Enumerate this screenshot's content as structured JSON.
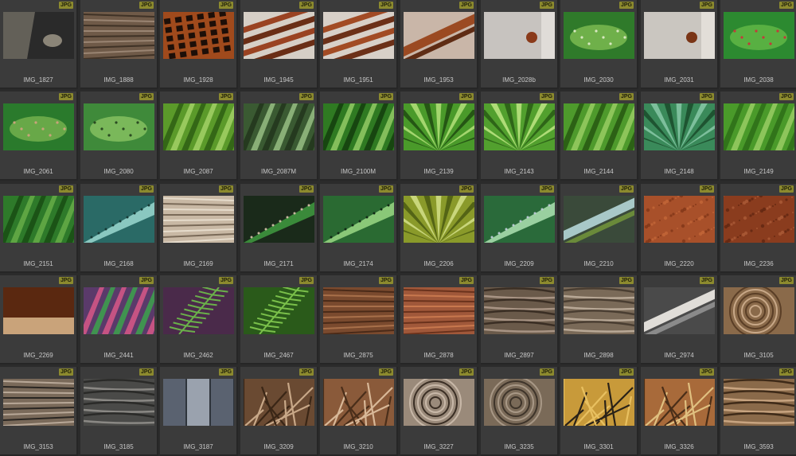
{
  "browser": {
    "badge_label": "JPG",
    "items": [
      {
        "name": "IMG_1827",
        "colors": [
          "#2a2a2a",
          "#8b8578",
          "#4a4640"
        ],
        "pattern": "rock"
      },
      {
        "name": "IMG_1888",
        "colors": [
          "#6f5a48",
          "#9a8573",
          "#3f3226"
        ],
        "pattern": "wood"
      },
      {
        "name": "IMG_1928",
        "colors": [
          "#a04a1c",
          "#1d0f08",
          "#c46a34"
        ],
        "pattern": "mesh"
      },
      {
        "name": "IMG_1945",
        "colors": [
          "#d6cfc6",
          "#9a4322",
          "#6a2e16"
        ],
        "pattern": "bars"
      },
      {
        "name": "IMG_1951",
        "colors": [
          "#d8d0c8",
          "#a24b24",
          "#6c3018"
        ],
        "pattern": "bars"
      },
      {
        "name": "IMG_1953",
        "colors": [
          "#c9b6a8",
          "#9b4a22",
          "#5f2c14"
        ],
        "pattern": "diag"
      },
      {
        "name": "IMG_2028b",
        "colors": [
          "#c7c3bf",
          "#8a3a1a",
          "#e0dcd8"
        ],
        "pattern": "bolt"
      },
      {
        "name": "IMG_2030",
        "colors": [
          "#2f7a2a",
          "#6fb04a",
          "#d8e8c0"
        ],
        "pattern": "cactus"
      },
      {
        "name": "IMG_2031",
        "colors": [
          "#cac6c0",
          "#7a3516",
          "#e2ded8"
        ],
        "pattern": "bolt"
      },
      {
        "name": "IMG_2038",
        "colors": [
          "#2c8a30",
          "#58b042",
          "#c43a3a"
        ],
        "pattern": "cactus"
      },
      {
        "name": "IMG_2061",
        "colors": [
          "#2a7a2c",
          "#68a848",
          "#c9a37a"
        ],
        "pattern": "cactus"
      },
      {
        "name": "IMG_2080",
        "colors": [
          "#3f8a3a",
          "#7ab85a",
          "#2a4a22"
        ],
        "pattern": "cactus"
      },
      {
        "name": "IMG_2087",
        "colors": [
          "#5b9a2a",
          "#a8d46a",
          "#2a5a12"
        ],
        "pattern": "leaf"
      },
      {
        "name": "IMG_2087M",
        "colors": [
          "#3a5a32",
          "#9ec488",
          "#20321a"
        ],
        "pattern": "leaf"
      },
      {
        "name": "IMG_2100M",
        "colors": [
          "#2f7a22",
          "#9ad06a",
          "#123a0c"
        ],
        "pattern": "leaf"
      },
      {
        "name": "IMG_2139",
        "colors": [
          "#4a9a2a",
          "#b4e07a",
          "#1e4a10"
        ],
        "pattern": "burst"
      },
      {
        "name": "IMG_2143",
        "colors": [
          "#52a02e",
          "#bfe684",
          "#285a14"
        ],
        "pattern": "burst"
      },
      {
        "name": "IMG_2144",
        "colors": [
          "#4e9a2c",
          "#9ed066",
          "#245210"
        ],
        "pattern": "leaf"
      },
      {
        "name": "IMG_2148",
        "colors": [
          "#3a8a5a",
          "#8ac8a8",
          "#1a4a2a"
        ],
        "pattern": "burst"
      },
      {
        "name": "IMG_2149",
        "colors": [
          "#4a9a2a",
          "#9ed068",
          "#2a6a16"
        ],
        "pattern": "leaf"
      },
      {
        "name": "IMG_2151",
        "colors": [
          "#2e7a2a",
          "#6ab04a",
          "#164a12"
        ],
        "pattern": "leaf"
      },
      {
        "name": "IMG_2168",
        "colors": [
          "#2a6a66",
          "#8ac8c0",
          "#163a36"
        ],
        "pattern": "aloe"
      },
      {
        "name": "IMG_2169",
        "colors": [
          "#c8b8a4",
          "#7a6a58",
          "#e6dccc"
        ],
        "pattern": "wood"
      },
      {
        "name": "IMG_2171",
        "colors": [
          "#1a2a1a",
          "#3a8a3a",
          "#c8b8a0"
        ],
        "pattern": "aloe"
      },
      {
        "name": "IMG_2174",
        "colors": [
          "#2a6a32",
          "#8ac878",
          "#122a16"
        ],
        "pattern": "aloe"
      },
      {
        "name": "IMG_2206",
        "colors": [
          "#8a9a2a",
          "#d4e08a",
          "#4a5a12"
        ],
        "pattern": "burst"
      },
      {
        "name": "IMG_2209",
        "colors": [
          "#2a6a3a",
          "#9ad0a0",
          "#b8c8d0"
        ],
        "pattern": "aloe"
      },
      {
        "name": "IMG_2210",
        "colors": [
          "#3a4a3a",
          "#a8c8c8",
          "#6a8a3a"
        ],
        "pattern": "diag"
      },
      {
        "name": "IMG_2220",
        "colors": [
          "#a8502a",
          "#7a3216",
          "#c86a3a"
        ],
        "pattern": "speck"
      },
      {
        "name": "IMG_2236",
        "colors": [
          "#8a3c1e",
          "#5a220e",
          "#b0603a"
        ],
        "pattern": "speck"
      },
      {
        "name": "IMG_2269",
        "colors": [
          "#9a4a1c",
          "#5a2810",
          "#c9a37a"
        ],
        "pattern": "rust"
      },
      {
        "name": "IMG_2441",
        "colors": [
          "#5a3a6a",
          "#3aaa4a",
          "#e05a8a"
        ],
        "pattern": "leaf"
      },
      {
        "name": "IMG_2462",
        "colors": [
          "#4a2a4a",
          "#6ab04a",
          "#2a1a2a"
        ],
        "pattern": "fern"
      },
      {
        "name": "IMG_2467",
        "colors": [
          "#2a5a1a",
          "#7ac04a",
          "#14320c"
        ],
        "pattern": "fern"
      },
      {
        "name": "IMG_2875",
        "colors": [
          "#7a4a2e",
          "#a8704a",
          "#4a2a18"
        ],
        "pattern": "wood"
      },
      {
        "name": "IMG_2878",
        "colors": [
          "#a0583a",
          "#c8784e",
          "#6a321c"
        ],
        "pattern": "wood"
      },
      {
        "name": "IMG_2897",
        "colors": [
          "#6a5a4a",
          "#a89484",
          "#3a2e24"
        ],
        "pattern": "bark"
      },
      {
        "name": "IMG_2898",
        "colors": [
          "#7a6a58",
          "#b8a896",
          "#4a3e32"
        ],
        "pattern": "bark"
      },
      {
        "name": "IMG_2974",
        "colors": [
          "#4a4a4a",
          "#e0ddd8",
          "#8a8a8a"
        ],
        "pattern": "diag"
      },
      {
        "name": "IMG_3105",
        "colors": [
          "#8a6a4a",
          "#c8a888",
          "#5a3e26"
        ],
        "pattern": "rings"
      },
      {
        "name": "IMG_3153",
        "colors": [
          "#7a6a5a",
          "#2a2622",
          "#b8a898"
        ],
        "pattern": "wood"
      },
      {
        "name": "IMG_3185",
        "colors": [
          "#4a4a48",
          "#8a8884",
          "#2a2a28"
        ],
        "pattern": "bark"
      },
      {
        "name": "IMG_3187",
        "colors": [
          "#5a6270",
          "#9aa2ae",
          "#2e343c"
        ],
        "pattern": "planks"
      },
      {
        "name": "IMG_3209",
        "colors": [
          "#6a4a32",
          "#c8a888",
          "#3a2616"
        ],
        "pattern": "sticks"
      },
      {
        "name": "IMG_3210",
        "colors": [
          "#8a5a3a",
          "#d8b898",
          "#4a2e1a"
        ],
        "pattern": "sticks"
      },
      {
        "name": "IMG_3227",
        "colors": [
          "#9a8a7a",
          "#3a2e24",
          "#c8b8a8"
        ],
        "pattern": "rings"
      },
      {
        "name": "IMG_3235",
        "colors": [
          "#7a6a58",
          "#3e342a",
          "#a89886"
        ],
        "pattern": "rings"
      },
      {
        "name": "IMG_3301",
        "colors": [
          "#c89a3a",
          "#2a2218",
          "#e8c060"
        ],
        "pattern": "sticks"
      },
      {
        "name": "IMG_3326",
        "colors": [
          "#a86a3a",
          "#e0c080",
          "#4a2e18"
        ],
        "pattern": "sticks"
      },
      {
        "name": "IMG_3593",
        "colors": [
          "#8a6a4a",
          "#c8a480",
          "#3e2a18"
        ],
        "pattern": "bark"
      }
    ]
  }
}
